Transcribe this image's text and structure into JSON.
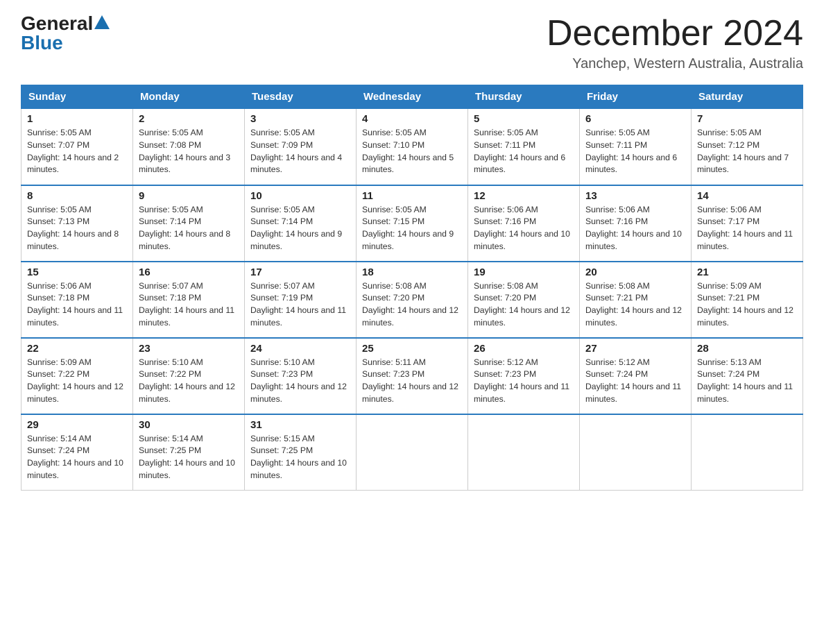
{
  "header": {
    "logo_general": "General",
    "logo_blue": "Blue",
    "month_title": "December 2024",
    "location": "Yanchep, Western Australia, Australia"
  },
  "columns": [
    "Sunday",
    "Monday",
    "Tuesday",
    "Wednesday",
    "Thursday",
    "Friday",
    "Saturday"
  ],
  "weeks": [
    [
      {
        "day": "1",
        "sunrise": "5:05 AM",
        "sunset": "7:07 PM",
        "daylight": "14 hours and 2 minutes."
      },
      {
        "day": "2",
        "sunrise": "5:05 AM",
        "sunset": "7:08 PM",
        "daylight": "14 hours and 3 minutes."
      },
      {
        "day": "3",
        "sunrise": "5:05 AM",
        "sunset": "7:09 PM",
        "daylight": "14 hours and 4 minutes."
      },
      {
        "day": "4",
        "sunrise": "5:05 AM",
        "sunset": "7:10 PM",
        "daylight": "14 hours and 5 minutes."
      },
      {
        "day": "5",
        "sunrise": "5:05 AM",
        "sunset": "7:11 PM",
        "daylight": "14 hours and 6 minutes."
      },
      {
        "day": "6",
        "sunrise": "5:05 AM",
        "sunset": "7:11 PM",
        "daylight": "14 hours and 6 minutes."
      },
      {
        "day": "7",
        "sunrise": "5:05 AM",
        "sunset": "7:12 PM",
        "daylight": "14 hours and 7 minutes."
      }
    ],
    [
      {
        "day": "8",
        "sunrise": "5:05 AM",
        "sunset": "7:13 PM",
        "daylight": "14 hours and 8 minutes."
      },
      {
        "day": "9",
        "sunrise": "5:05 AM",
        "sunset": "7:14 PM",
        "daylight": "14 hours and 8 minutes."
      },
      {
        "day": "10",
        "sunrise": "5:05 AM",
        "sunset": "7:14 PM",
        "daylight": "14 hours and 9 minutes."
      },
      {
        "day": "11",
        "sunrise": "5:05 AM",
        "sunset": "7:15 PM",
        "daylight": "14 hours and 9 minutes."
      },
      {
        "day": "12",
        "sunrise": "5:06 AM",
        "sunset": "7:16 PM",
        "daylight": "14 hours and 10 minutes."
      },
      {
        "day": "13",
        "sunrise": "5:06 AM",
        "sunset": "7:16 PM",
        "daylight": "14 hours and 10 minutes."
      },
      {
        "day": "14",
        "sunrise": "5:06 AM",
        "sunset": "7:17 PM",
        "daylight": "14 hours and 11 minutes."
      }
    ],
    [
      {
        "day": "15",
        "sunrise": "5:06 AM",
        "sunset": "7:18 PM",
        "daylight": "14 hours and 11 minutes."
      },
      {
        "day": "16",
        "sunrise": "5:07 AM",
        "sunset": "7:18 PM",
        "daylight": "14 hours and 11 minutes."
      },
      {
        "day": "17",
        "sunrise": "5:07 AM",
        "sunset": "7:19 PM",
        "daylight": "14 hours and 11 minutes."
      },
      {
        "day": "18",
        "sunrise": "5:08 AM",
        "sunset": "7:20 PM",
        "daylight": "14 hours and 12 minutes."
      },
      {
        "day": "19",
        "sunrise": "5:08 AM",
        "sunset": "7:20 PM",
        "daylight": "14 hours and 12 minutes."
      },
      {
        "day": "20",
        "sunrise": "5:08 AM",
        "sunset": "7:21 PM",
        "daylight": "14 hours and 12 minutes."
      },
      {
        "day": "21",
        "sunrise": "5:09 AM",
        "sunset": "7:21 PM",
        "daylight": "14 hours and 12 minutes."
      }
    ],
    [
      {
        "day": "22",
        "sunrise": "5:09 AM",
        "sunset": "7:22 PM",
        "daylight": "14 hours and 12 minutes."
      },
      {
        "day": "23",
        "sunrise": "5:10 AM",
        "sunset": "7:22 PM",
        "daylight": "14 hours and 12 minutes."
      },
      {
        "day": "24",
        "sunrise": "5:10 AM",
        "sunset": "7:23 PM",
        "daylight": "14 hours and 12 minutes."
      },
      {
        "day": "25",
        "sunrise": "5:11 AM",
        "sunset": "7:23 PM",
        "daylight": "14 hours and 12 minutes."
      },
      {
        "day": "26",
        "sunrise": "5:12 AM",
        "sunset": "7:23 PM",
        "daylight": "14 hours and 11 minutes."
      },
      {
        "day": "27",
        "sunrise": "5:12 AM",
        "sunset": "7:24 PM",
        "daylight": "14 hours and 11 minutes."
      },
      {
        "day": "28",
        "sunrise": "5:13 AM",
        "sunset": "7:24 PM",
        "daylight": "14 hours and 11 minutes."
      }
    ],
    [
      {
        "day": "29",
        "sunrise": "5:14 AM",
        "sunset": "7:24 PM",
        "daylight": "14 hours and 10 minutes."
      },
      {
        "day": "30",
        "sunrise": "5:14 AM",
        "sunset": "7:25 PM",
        "daylight": "14 hours and 10 minutes."
      },
      {
        "day": "31",
        "sunrise": "5:15 AM",
        "sunset": "7:25 PM",
        "daylight": "14 hours and 10 minutes."
      },
      null,
      null,
      null,
      null
    ]
  ],
  "labels": {
    "sunrise": "Sunrise: ",
    "sunset": "Sunset: ",
    "daylight": "Daylight: "
  }
}
